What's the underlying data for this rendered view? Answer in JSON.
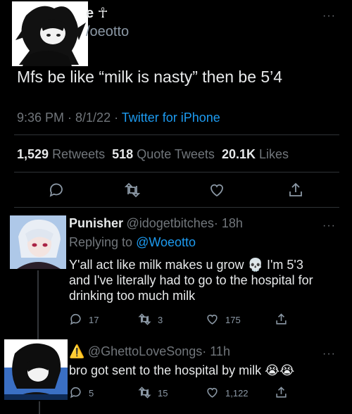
{
  "main": {
    "display_name": "e ☥",
    "handle": "/oeotto",
    "text": "Mfs be like “milk is nasty” then be 5’4",
    "time": "9:36 PM · 8/1/22 · ",
    "source": "Twitter for iPhone",
    "stats": {
      "retweets": "1,529",
      "retweets_label": "Retweets",
      "quotes": "518",
      "quotes_label": "Quote Tweets",
      "likes": "20.1K",
      "likes_label": "Likes"
    },
    "more": "···"
  },
  "replies": [
    {
      "name": "Punisher",
      "handle": "@idogetbitches",
      "time": "· 18h",
      "replying_prefix": "Replying to ",
      "replying_to": "@Woeotto",
      "text_line1": "Y'all act like milk makes u grow ",
      "text_emoji": "💀",
      "text_line1_end": " I'm 5'3",
      "text_line2": "and I've literally had to go to the hospital for",
      "text_line3": "drinking too much milk",
      "replies": "17",
      "retweets": "3",
      "likes": "175",
      "more": "···"
    },
    {
      "name_emoji": "⚠️",
      "handle": "@GhettoLoveSongs",
      "time": "· 11h",
      "text": "bro got sent to the hospital by milk ",
      "text_emoji": "😭😭",
      "replies": "5",
      "retweets": "15",
      "likes": "1,122",
      "more": "···"
    }
  ],
  "colors": {
    "background": "#000000",
    "text": "#e7e9ea",
    "muted": "#71767b",
    "accent": "#1d9bf0",
    "divider": "#2f3336"
  },
  "icons": {
    "reply": "comment-icon",
    "retweet": "retweet-icon",
    "like": "heart-icon",
    "share": "share-icon"
  }
}
